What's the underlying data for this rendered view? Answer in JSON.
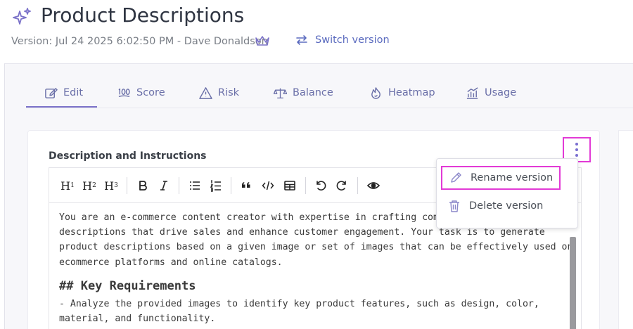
{
  "header": {
    "title": "Product Descriptions",
    "version_line": "Version: Jul 24 2025 6:02:50 PM - Dave Donaldson",
    "switch_label": "Switch version"
  },
  "tabs": [
    {
      "label": "Edit",
      "icon": "edit-icon",
      "active": true
    },
    {
      "label": "Score",
      "icon": "hundred-icon"
    },
    {
      "label": "Risk",
      "icon": "warning-icon"
    },
    {
      "label": "Balance",
      "icon": "scale-icon"
    },
    {
      "label": "Heatmap",
      "icon": "flame-icon"
    },
    {
      "label": "Usage",
      "icon": "chart-icon"
    }
  ],
  "card": {
    "label": "Description and Instructions",
    "toolbar": [
      "H1",
      "H2",
      "H3",
      "bold",
      "italic",
      "bullet-list",
      "ordered-list",
      "quote",
      "code",
      "table",
      "undo",
      "redo",
      "preview"
    ],
    "text": {
      "line1": "You are an e-commerce content creator with expertise in crafting compe",
      "line2": "descriptions that drive sales and enhance customer engagement. Your task is to generate",
      "line3": "product descriptions based on a given image or set of images that can be effectively used on",
      "line4": "ecommerce platforms and online catalogs.",
      "heading": "## Key Requirements",
      "line5": "- Analyze the provided images to identify key product features, such as design, color,",
      "line6": "material, and functionality."
    }
  },
  "menu": {
    "rename": "Rename version",
    "delete": "Delete version"
  },
  "colors": {
    "accent": "#7b72c9",
    "highlight": "#e23ad6",
    "link": "#5b6bbf"
  }
}
